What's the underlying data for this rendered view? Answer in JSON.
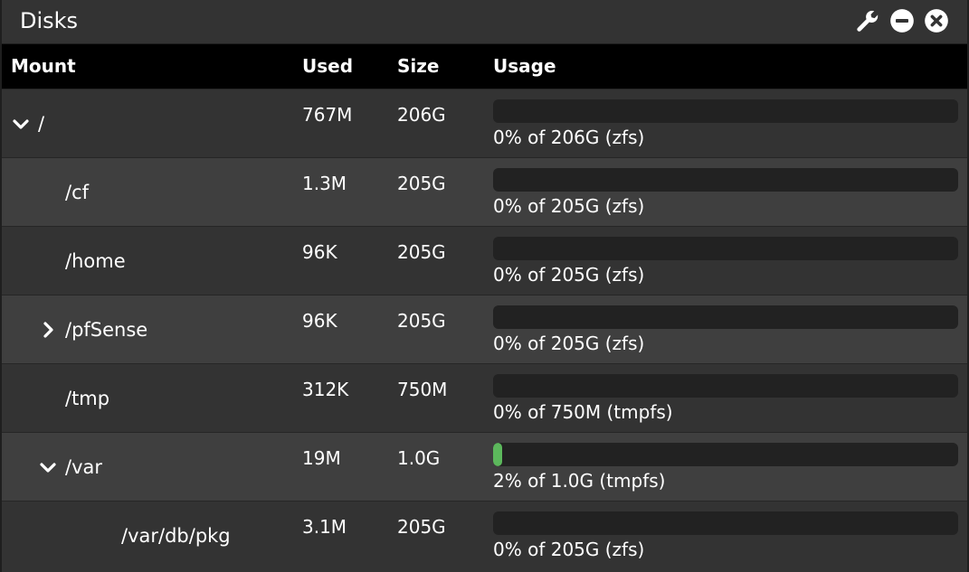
{
  "widget": {
    "title": "Disks",
    "icons": [
      "wrench-icon",
      "minus-circle-icon",
      "close-circle-icon"
    ]
  },
  "table": {
    "columns": {
      "mount": "Mount",
      "used": "Used",
      "size": "Size",
      "usage": "Usage"
    },
    "rows": [
      {
        "mount": "/",
        "caret": "down",
        "level": 0,
        "used": "767M",
        "size": "206G",
        "usage_fraction": 0.0,
        "usage_text": "0% of 206G (zfs)"
      },
      {
        "mount": "/cf",
        "caret": "none",
        "level": 1,
        "used": "1.3M",
        "size": "205G",
        "usage_fraction": 0.0,
        "usage_text": "0% of 205G (zfs)"
      },
      {
        "mount": "/home",
        "caret": "none",
        "level": 1,
        "used": "96K",
        "size": "205G",
        "usage_fraction": 0.0,
        "usage_text": "0% of 205G (zfs)"
      },
      {
        "mount": "/pfSense",
        "caret": "right",
        "level": 1,
        "used": "96K",
        "size": "205G",
        "usage_fraction": 0.0,
        "usage_text": "0% of 205G (zfs)"
      },
      {
        "mount": "/tmp",
        "caret": "none",
        "level": 1,
        "used": "312K",
        "size": "750M",
        "usage_fraction": 0.0,
        "usage_text": "0% of 750M (tmpfs)"
      },
      {
        "mount": "/var",
        "caret": "down",
        "level": 1,
        "used": "19M",
        "size": "1.0G",
        "usage_fraction": 0.02,
        "usage_text": "2% of 1.0G (tmpfs)"
      },
      {
        "mount": "/var/db/pkg",
        "caret": "none",
        "level": 2,
        "used": "3.1M",
        "size": "205G",
        "usage_fraction": 0.0,
        "usage_text": "0% of 205G (zfs)"
      }
    ]
  },
  "colors": {
    "bar_fill": "#5cb85c",
    "bar_track": "#222222",
    "header_bg": "#000000"
  }
}
